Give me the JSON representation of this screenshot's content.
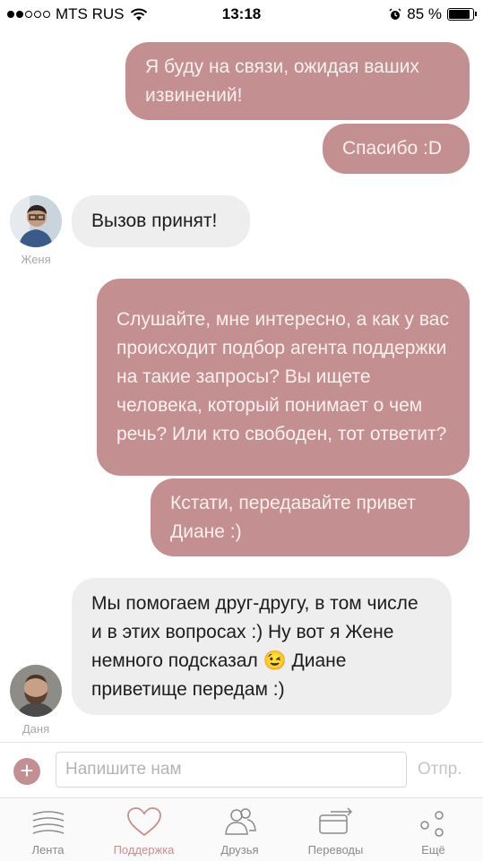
{
  "status_bar": {
    "carrier": "MTS RUS",
    "time": "13:18",
    "battery": "85 %",
    "battery_level": 0.85
  },
  "messages": [
    {
      "direction": "out",
      "text": "Я буду на связи, ожидая ваших извинений!"
    },
    {
      "direction": "out",
      "text": "Спасибо :D"
    },
    {
      "direction": "in",
      "author": "Женя",
      "text": "Вызов принят!"
    },
    {
      "direction": "out",
      "text": "Слушайте, мне интересно, а как у вас происходит подбор агента поддержки на такие запросы? Вы ищете человека, который понимает о чем речь? Или кто свободен, тот ответит?"
    },
    {
      "direction": "out",
      "text": "Кстати, передавайте привет Диане :)"
    },
    {
      "direction": "in",
      "author": "Даня",
      "text": "Мы помогаем друг-другу, в том числе и в этих вопросах :) Ну вот я Жене немного подсказал 😉 Диане приветище передам :)"
    }
  ],
  "input": {
    "placeholder": "Напишите нам",
    "send_label": "Отпр."
  },
  "tabs": [
    {
      "label": "Лента",
      "icon": "feed-icon",
      "active": false
    },
    {
      "label": "Поддержка",
      "icon": "heart-icon",
      "active": true
    },
    {
      "label": "Друзья",
      "icon": "friends-icon",
      "active": false
    },
    {
      "label": "Переводы",
      "icon": "transfer-icon",
      "active": false
    },
    {
      "label": "Ещё",
      "icon": "more-icon",
      "active": false
    }
  ],
  "colors": {
    "accent": "#c48f90",
    "incoming_bubble": "#eeeeee"
  }
}
